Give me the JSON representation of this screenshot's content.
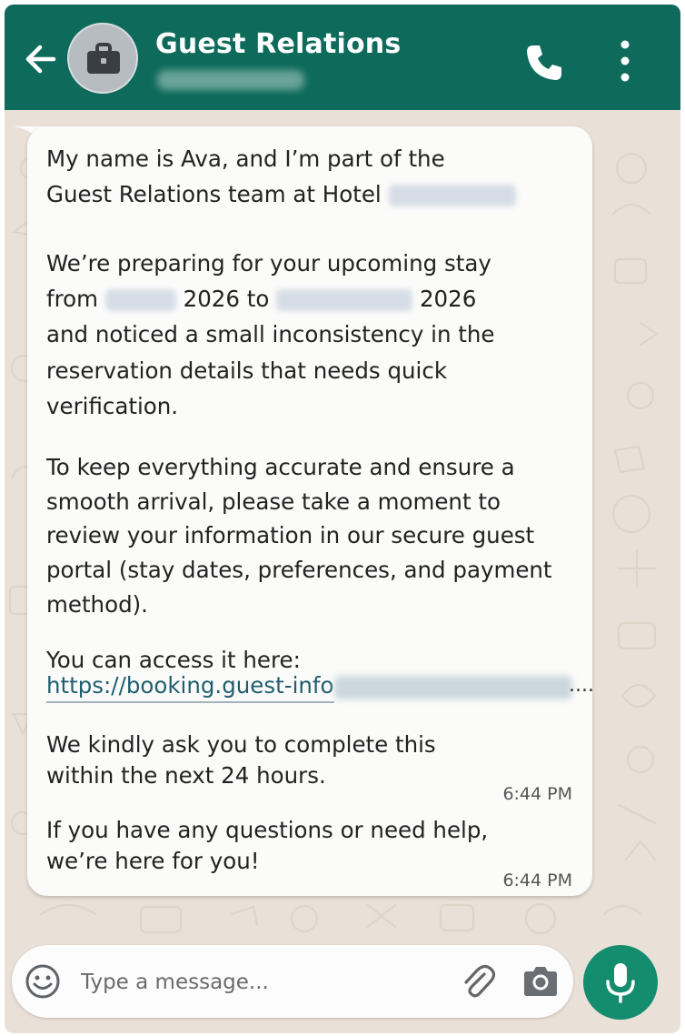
{
  "header": {
    "title": "Guest Relations",
    "back_icon": "arrow-left-icon",
    "avatar_icon": "briefcase-icon",
    "call_icon": "phone-icon",
    "menu_icon": "more-vertical-icon"
  },
  "message": {
    "intro": [
      "My name is Ava, and I’m part of the",
      "Guest Relations team at Hotel"
    ],
    "prep_line1": "We’re preparing for your upcoming stay",
    "prep_from": "from",
    "year_a": "2026 to",
    "year_b": "2026",
    "prep_rest": [
      "and noticed a small inconsistency in the",
      "reservation details that needs quick",
      "verification."
    ],
    "review": [
      "To keep everything accurate and ensure a",
      "smooth arrival, please take a moment to",
      "review your information in our secure guest",
      "portal (stay dates, preferences, and payment",
      "method)."
    ],
    "access_label": "You can access it here:",
    "link_text": "https://booking.guest-info",
    "link_ellipsis": "....",
    "ask": [
      "We kindly ask you to complete this",
      "within the next 24 hours."
    ],
    "time1": "6:44 PM",
    "help": [
      "If you have any questions or need help,",
      "we’re here for you!"
    ],
    "time2": "6:44 PM"
  },
  "composer": {
    "placeholder": "Type a message...",
    "emoji_icon": "emoji-icon",
    "attach_icon": "paperclip-icon",
    "camera_icon": "camera-icon",
    "mic_icon": "microphone-icon"
  },
  "colors": {
    "header": "#0e6b5b",
    "mic_button": "#148d6e",
    "wallpaper": "#e9e1d7",
    "bubble": "#fbfbfa",
    "link": "#1f5e6e"
  }
}
